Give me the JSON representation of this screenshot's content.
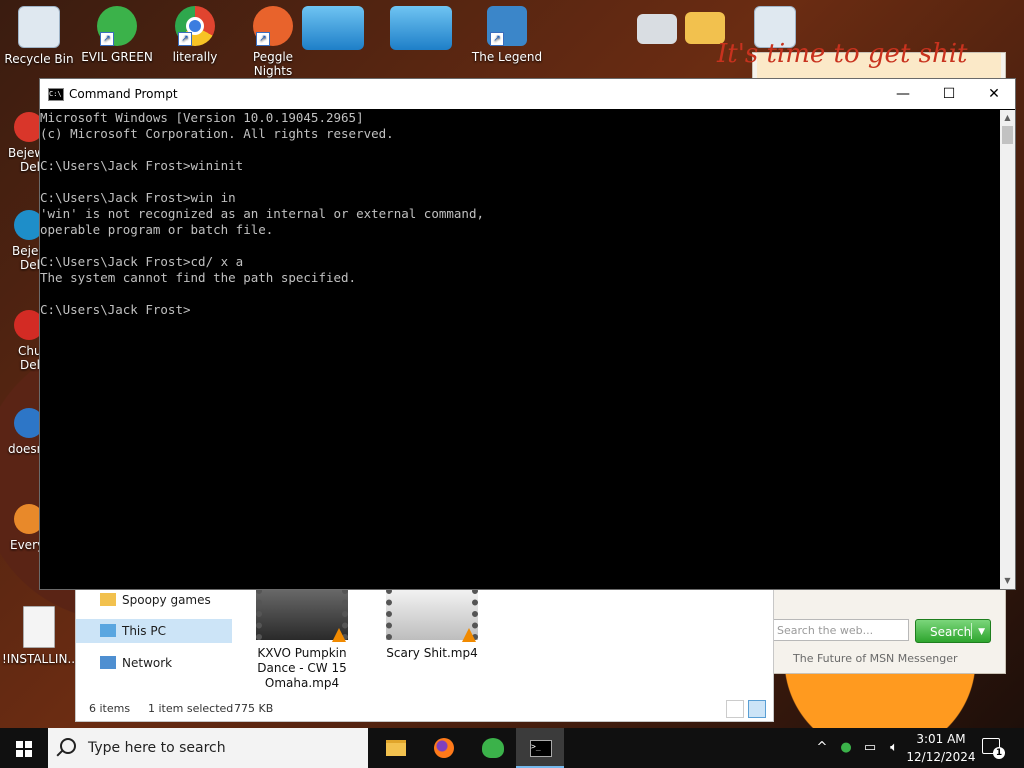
{
  "desktop": {
    "top_icons": [
      {
        "label": "Recycle Bin",
        "icon": "recycle-bin-icon",
        "color": "#dfe8f0"
      },
      {
        "label": "EVIL GREEN",
        "icon": "msn-buddy-icon",
        "color": "#3bb24a"
      },
      {
        "label": "literally",
        "icon": "chrome-icon",
        "color": "#e0442f"
      },
      {
        "label": "Peggle Nights",
        "icon": "peggle-icon",
        "color": "#e8632c"
      },
      {
        "label": "The Legend",
        "icon": "game-icon",
        "color": "#3b86c9"
      }
    ],
    "left_icons": [
      {
        "label": "Bejew",
        "sub": "Del",
        "icon": "bejeweled-icon",
        "color": "#d9362a"
      },
      {
        "label": "Bejew",
        "sub": "Del",
        "icon": "bejeweled-icon",
        "color": "#1e8ec9"
      },
      {
        "label": "Chu",
        "sub": "Del",
        "icon": "chuzzle-icon",
        "color": "#d32b24"
      },
      {
        "label": "doesn",
        "sub": "",
        "icon": "app-icon",
        "color": "#2d76c7"
      },
      {
        "label": "Every",
        "sub": "",
        "icon": "app-icon",
        "color": "#e8892a"
      }
    ],
    "installer_icon": {
      "label": "!INSTALLIN...",
      "icon": "document-icon"
    }
  },
  "msn": {
    "banner_text": "It's time to get shit",
    "search_placeholder": "Search the web...",
    "search_button": "Search",
    "footer_text": "The Future of MSN Messenger"
  },
  "explorer": {
    "nav_items": [
      {
        "label": "Spoopy games",
        "icon": "folder-icon",
        "selected": false
      },
      {
        "label": "This PC",
        "icon": "this-pc-icon",
        "selected": true
      },
      {
        "label": "Network",
        "icon": "network-icon",
        "selected": false
      }
    ],
    "files": [
      {
        "name": "KXVO Pumpkin Dance - CW 15 Omaha.mp4",
        "icon": "vlc-video-icon"
      },
      {
        "name": "Scary Shit.mp4",
        "icon": "vlc-video-icon"
      }
    ],
    "status": {
      "count": "6 items",
      "selected": "1 item selected",
      "size": "775 KB"
    }
  },
  "cmd": {
    "title": "Command Prompt",
    "output": "Microsoft Windows [Version 10.0.19045.2965]\n(c) Microsoft Corporation. All rights reserved.\n\nC:\\Users\\Jack Frost>wininit\n\nC:\\Users\\Jack Frost>win in\n'win' is not recognized as an internal or external command,\noperable program or batch file.\n\nC:\\Users\\Jack Frost>cd/ x a\nThe system cannot find the path specified.\n\nC:\\Users\\Jack Frost>",
    "controls": {
      "minimize": "—",
      "maximize": "☐",
      "close": "✕"
    }
  },
  "taskbar": {
    "search_placeholder": "Type here to search",
    "apps": [
      {
        "name": "File Explorer",
        "icon": "file-explorer-icon",
        "active": false
      },
      {
        "name": "Firefox",
        "icon": "firefox-icon",
        "active": false
      },
      {
        "name": "MSN Messenger",
        "icon": "msn-messenger-icon",
        "active": false
      },
      {
        "name": "Command Prompt",
        "icon": "cmd-icon",
        "active": true
      }
    ],
    "tray": {
      "chevron": "^",
      "time": "3:01 AM",
      "date": "12/12/2024",
      "notifications": "1"
    }
  }
}
